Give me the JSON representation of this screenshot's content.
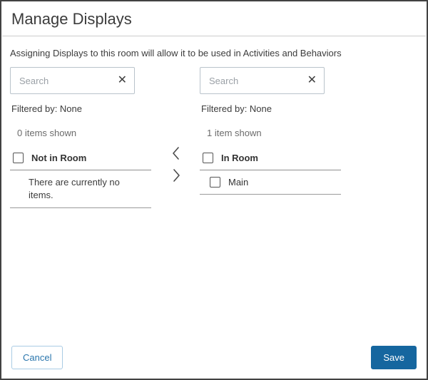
{
  "dialog": {
    "title": "Manage Displays",
    "description": "Assigning Displays to this room will allow it to be used in Activities and Behaviors"
  },
  "left_panel": {
    "search": {
      "placeholder": "Search",
      "value": ""
    },
    "filtered_by": "Filtered by: None",
    "items_shown": "0 items shown",
    "list_header": "Not in Room",
    "empty_message": "There are currently no items."
  },
  "right_panel": {
    "search": {
      "placeholder": "Search",
      "value": ""
    },
    "filtered_by": "Filtered by: None",
    "items_shown": "1 item shown",
    "list_header": "In Room",
    "items": [
      {
        "label": "Main"
      }
    ]
  },
  "transfer": {
    "left_icon": "chevron-left",
    "right_icon": "chevron-right"
  },
  "footer": {
    "cancel_label": "Cancel",
    "save_label": "Save"
  },
  "icons": {
    "clear": "✕"
  },
  "colors": {
    "primary_button": "#15669f",
    "cancel_border": "#a9cbe4",
    "cancel_text": "#2a76ad",
    "dialog_border": "#424242"
  }
}
